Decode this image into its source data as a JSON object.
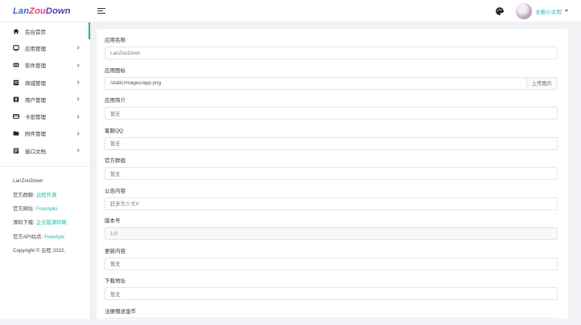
{
  "logo": {
    "part1": "Lan",
    "part2": "Zou",
    "part3": "Down"
  },
  "user": {
    "name": "全能小太阳"
  },
  "sidebar": {
    "items": [
      {
        "label": "后台首页",
        "icon": "home-icon"
      },
      {
        "label": "应用管理",
        "icon": "app-icon"
      },
      {
        "label": "软件管理",
        "icon": "software-icon"
      },
      {
        "label": "商城管理",
        "icon": "shop-icon"
      },
      {
        "label": "用户管理",
        "icon": "user-icon"
      },
      {
        "label": "卡密管理",
        "icon": "card-icon"
      },
      {
        "label": "附件管理",
        "icon": "folder-icon"
      },
      {
        "label": "接口文档",
        "icon": "doc-icon"
      }
    ],
    "info": {
      "title": "LanZouDown",
      "group_label": "官方群聊:",
      "group_link": "云程开源",
      "site_label": "官方网址:",
      "site_link": "FreeApks",
      "download_label": "源码下载:",
      "download_link": "企业版源码网",
      "api_label": "官方API站点:",
      "api_link": "FreeApis",
      "copyright": "Copyright © 云程 2022."
    }
  },
  "form": {
    "fields": [
      {
        "label": "应用名称",
        "value": "LanZouDown"
      },
      {
        "label": "应用图标",
        "value": "/static/images/app.png",
        "button": "上传图片"
      },
      {
        "label": "应用简介",
        "value": "暂无"
      },
      {
        "label": "客服QQ",
        "value": "暂无"
      },
      {
        "label": "官方群组",
        "value": "暂无"
      },
      {
        "label": "公告内容",
        "value": "赶多负少大V"
      },
      {
        "label": "版本号",
        "value": "1.0"
      },
      {
        "label": "更新内容",
        "value": "暂无"
      },
      {
        "label": "下载地址",
        "value": "暂无"
      },
      {
        "label": "注册赠送金币",
        "value": ""
      }
    ]
  },
  "colors": {
    "accent": "#1fb8a3"
  }
}
